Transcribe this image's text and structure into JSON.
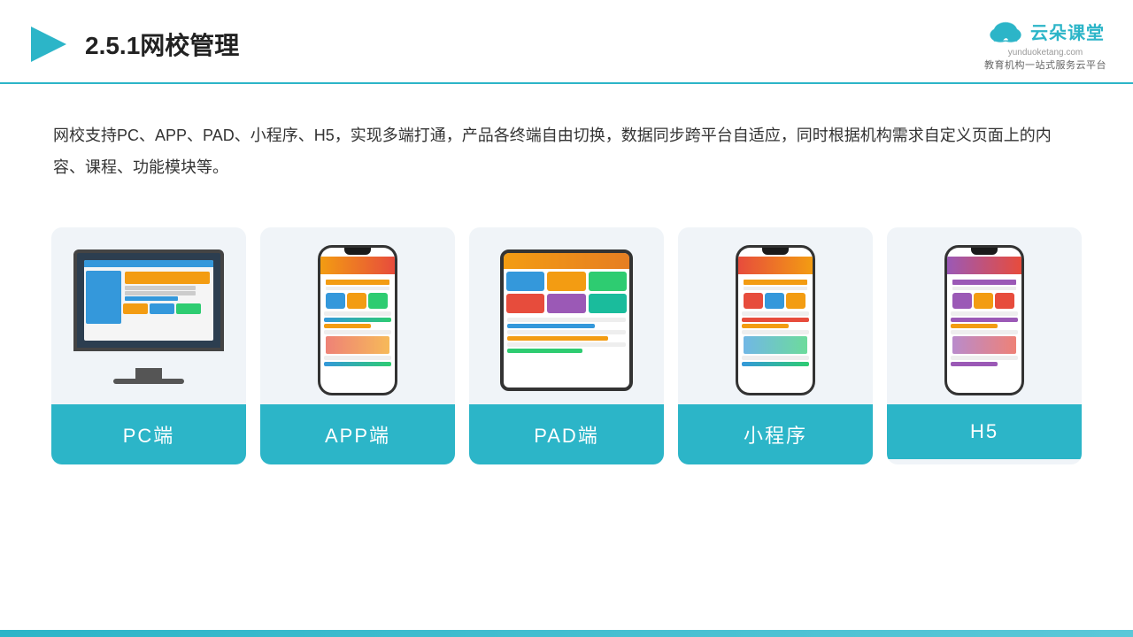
{
  "header": {
    "section_number": "2.5.1",
    "title": "网校管理",
    "brand": {
      "name": "云朵课堂",
      "url": "yunduoketang.com",
      "tagline": "教育机构一站式服务云平台"
    }
  },
  "description": {
    "text": "网校支持PC、APP、PAD、小程序、H5，实现多端打通，产品各终端自由切换，数据同步跨平台自适应，同时根据机构需求自定义页面上的内容、课程、功能模块等。"
  },
  "cards": [
    {
      "id": "pc",
      "label": "PC端",
      "type": "pc"
    },
    {
      "id": "app",
      "label": "APP端",
      "type": "phone"
    },
    {
      "id": "pad",
      "label": "PAD端",
      "type": "tablet"
    },
    {
      "id": "miniprogram",
      "label": "小程序",
      "type": "phone"
    },
    {
      "id": "h5",
      "label": "H5",
      "type": "phone"
    }
  ],
  "colors": {
    "accent": "#2cb5c8",
    "title": "#222222",
    "text": "#333333",
    "card_bg": "#f0f4f8"
  }
}
